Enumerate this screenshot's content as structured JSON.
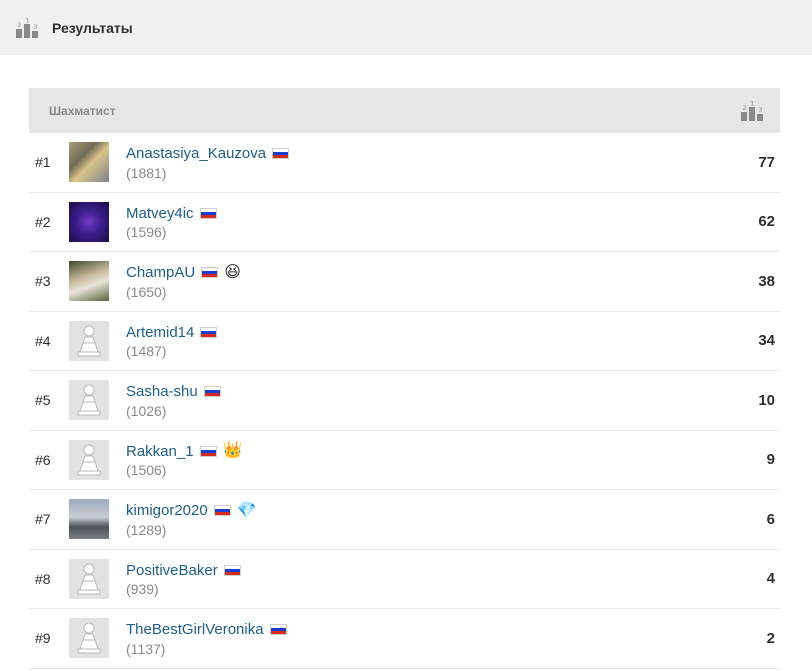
{
  "header": {
    "title": "Результаты",
    "icon": "podium-icon"
  },
  "table": {
    "column_player": "Шахматист",
    "column_score_icon": "podium-icon",
    "rows": [
      {
        "rank": "#1",
        "name": "Anastasiya_Kauzova",
        "rating": "(1881)",
        "score": "77",
        "badge": "",
        "avatar": "photo"
      },
      {
        "rank": "#2",
        "name": "Matvey4ic",
        "rating": "(1596)",
        "score": "62",
        "badge": "",
        "avatar": "photo"
      },
      {
        "rank": "#3",
        "name": "ChampAU",
        "rating": "(1650)",
        "score": "38",
        "badge": "😆",
        "avatar": "photo"
      },
      {
        "rank": "#4",
        "name": "Artemid14",
        "rating": "(1487)",
        "score": "34",
        "badge": "",
        "avatar": "pawn"
      },
      {
        "rank": "#5",
        "name": "Sasha-shu",
        "rating": "(1026)",
        "score": "10",
        "badge": "",
        "avatar": "pawn"
      },
      {
        "rank": "#6",
        "name": "Rakkan_1",
        "rating": "(1506)",
        "score": "9",
        "badge": "👑",
        "avatar": "pawn"
      },
      {
        "rank": "#7",
        "name": "kimigor2020",
        "rating": "(1289)",
        "score": "6",
        "badge": "💎",
        "avatar": "photo"
      },
      {
        "rank": "#8",
        "name": "PositiveBaker",
        "rating": "(939)",
        "score": "4",
        "badge": "",
        "avatar": "pawn"
      },
      {
        "rank": "#9",
        "name": "TheBestGirlVeronika",
        "rating": "(1137)",
        "score": "2",
        "badge": "",
        "avatar": "pawn"
      }
    ]
  },
  "colors": {
    "link": "#1f5d8a",
    "header_bg": "#f1f1f1",
    "table_header_bg": "#e6e6e6",
    "muted": "#8b8987"
  }
}
